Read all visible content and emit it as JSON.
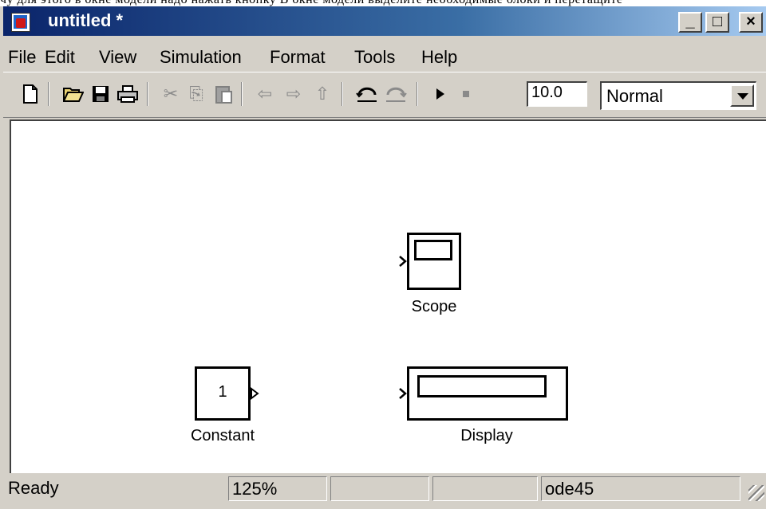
{
  "window": {
    "title": "untitled *"
  },
  "caption_buttons": {
    "minimize": "_",
    "maximize": "□",
    "close": "×"
  },
  "menu": [
    {
      "label": "File"
    },
    {
      "label": "Edit"
    },
    {
      "label": "View"
    },
    {
      "label": "Simulation"
    },
    {
      "label": "Format"
    },
    {
      "label": "Tools"
    },
    {
      "label": "Help"
    }
  ],
  "toolbar": {
    "stop_time": "10.0",
    "sim_mode": "Normal",
    "icons": {
      "new": "new-document-icon",
      "open": "open-folder-icon",
      "save": "save-icon",
      "print": "print-icon",
      "cut": "cut-icon",
      "copy": "copy-icon",
      "paste": "paste-icon",
      "back": "arrow-left-icon",
      "forward": "arrow-right-icon",
      "up": "arrow-up-icon",
      "undo": "undo-icon",
      "redo": "redo-icon",
      "start": "play-icon",
      "stop": "stop-icon"
    }
  },
  "blocks": {
    "scope": {
      "label": "Scope"
    },
    "constant": {
      "label": "Constant",
      "value": "1"
    },
    "display": {
      "label": "Display"
    }
  },
  "status": {
    "state": "Ready",
    "zoom": "125%",
    "solver": "ode45"
  }
}
